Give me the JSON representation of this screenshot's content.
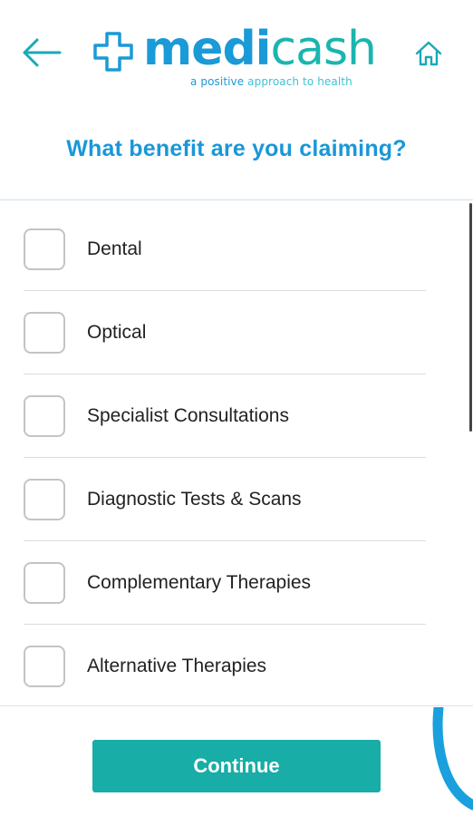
{
  "header": {
    "back_icon": "arrow-left-icon",
    "home_icon": "home-icon",
    "logo": {
      "word_part1": "medi",
      "word_part2": "cash",
      "tagline_part1": "a positive ",
      "tagline_part2": "approach to health"
    }
  },
  "page": {
    "title": "What benefit are you claiming?"
  },
  "benefits": [
    {
      "label": "Dental",
      "checked": false
    },
    {
      "label": "Optical",
      "checked": false
    },
    {
      "label": "Specialist Consultations",
      "checked": false
    },
    {
      "label": "Diagnostic Tests & Scans",
      "checked": false
    },
    {
      "label": "Complementary Therapies",
      "checked": false
    },
    {
      "label": "Alternative Therapies",
      "checked": false
    }
  ],
  "footer": {
    "continue_label": "Continue"
  },
  "colors": {
    "brand_blue": "#1a9ad6",
    "brand_teal": "#18ada7",
    "title_blue": "#1a97d8"
  }
}
